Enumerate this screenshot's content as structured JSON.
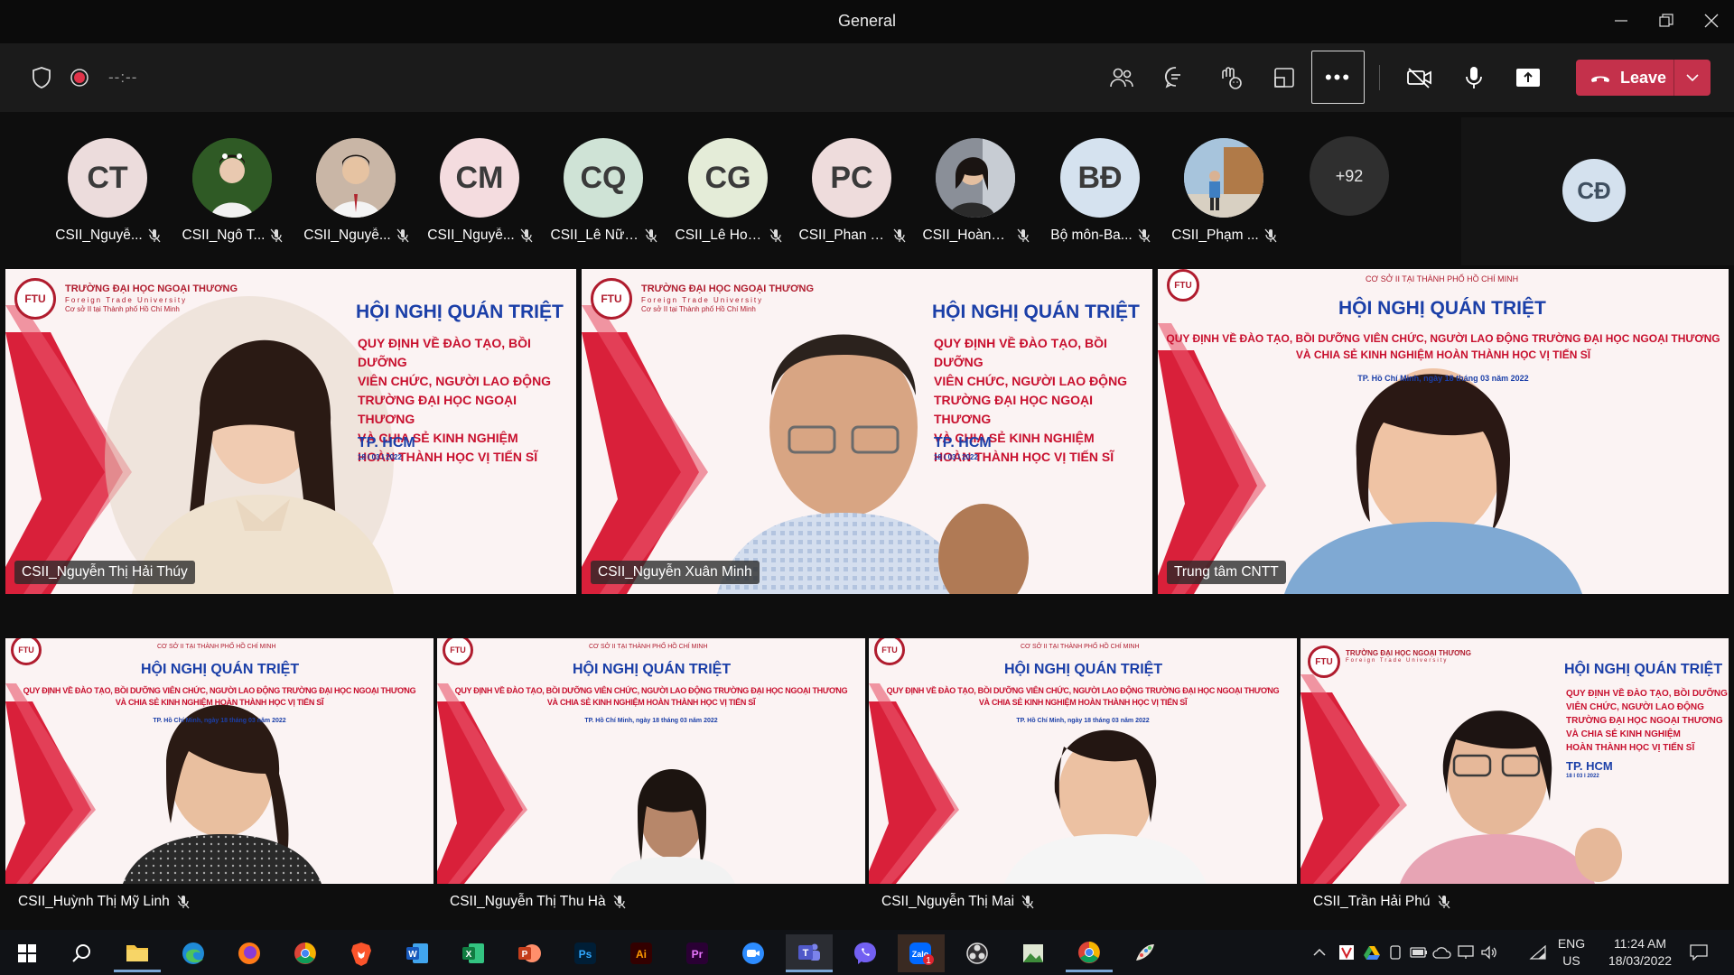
{
  "window": {
    "title": "General"
  },
  "toolbar": {
    "timer": "--:--",
    "more_label": "•••",
    "leave_label": "Leave"
  },
  "participants": [
    {
      "initials": "CT",
      "name": "CSII_Nguyễ...",
      "color": "#ecdcdc",
      "photo": false
    },
    {
      "initials": "",
      "name": "CSII_Ngô T...",
      "color": "#2f5a25",
      "photo": true
    },
    {
      "initials": "",
      "name": "CSII_Nguyễ...",
      "color": "#c9b6a6",
      "photo": true
    },
    {
      "initials": "CM",
      "name": "CSII_Nguyễ...",
      "color": "#f4dcdf",
      "photo": false
    },
    {
      "initials": "CQ",
      "name": "CSII_Lê Nữ ...",
      "color": "#cfe3d6",
      "photo": false
    },
    {
      "initials": "CG",
      "name": "CSII_Lê Hoà...",
      "color": "#e4ecd8",
      "photo": false
    },
    {
      "initials": "PC",
      "name": "CSII_Phan T...",
      "color": "#eedcdc",
      "photo": false
    },
    {
      "initials": "",
      "name": "CSII_Hoàng ...",
      "color": "#8a8f98",
      "photo": true
    },
    {
      "initials": "BĐ",
      "name": "Bộ môn-Ba...",
      "color": "#d5e2ef",
      "photo": false
    },
    {
      "initials": "",
      "name": "CSII_Phạm ...",
      "color": "#a7c4dc",
      "photo": true
    }
  ],
  "more_participants": "+92",
  "self": {
    "initials": "CĐ"
  },
  "tiles_top": [
    {
      "name": "CSII_Nguyễn Thị Hải Thúy"
    },
    {
      "name": "CSII_Nguyễn Xuân Minh"
    },
    {
      "name": "Trung tâm CNTT"
    }
  ],
  "tiles_bottom": [
    {
      "name": "CSII_Huỳnh Thị Mỹ Linh"
    },
    {
      "name": "CSII_Nguyễn Thị Thu Hà"
    },
    {
      "name": "CSII_Nguyễn Thị Mai"
    },
    {
      "name": "CSII_Trần Hải Phú"
    }
  ],
  "slide": {
    "school": "TRƯỜNG ĐẠI HỌC NGOẠI THƯƠNG",
    "school_en": "Foreign Trade University",
    "campus": "Cơ sở II tại Thành phố Hồ Chí Minh",
    "campus_caps": "CƠ SỞ II TẠI THÀNH PHỐ HỒ CHÍ MINH",
    "title": "HỘI NGHỊ QUÁN TRIỆT",
    "body_lines": [
      "QUY ĐỊNH VỀ ĐÀO TẠO, BỒI DƯỠNG",
      "VIÊN CHỨC, NGƯỜI LAO ĐỘNG",
      "TRƯỜNG ĐẠI HỌC NGOẠI THƯƠNG",
      "VÀ CHIA SẺ KINH NGHIỆM",
      "HOÀN THÀNH HỌC VỊ TIẾN SĨ"
    ],
    "wide_line1": "QUY ĐỊNH VỀ ĐÀO TẠO, BỒI DƯỠNG VIÊN CHỨC, NGƯỜI LAO ĐỘNG TRƯỜNG ĐẠI HỌC NGOẠI THƯƠNG",
    "wide_line2": "VÀ CHIA SẺ KINH NGHIỆM HOÀN THÀNH HỌC VỊ TIẾN SĨ",
    "city": "TP. HCM",
    "date": "18 I 03 I 2022",
    "date_long": "TP. Hồ Chí Minh, ngày 18 tháng 03 năm 2022"
  },
  "taskbar": {
    "apps": [
      "start-icon",
      "search-icon",
      "file-explorer-icon",
      "edge-icon",
      "firefox-icon",
      "chrome-icon",
      "brave-icon",
      "word-icon",
      "excel-icon",
      "powerpoint-icon",
      "photoshop-icon",
      "illustrator-icon",
      "premiere-icon",
      "zoom-icon",
      "teams-icon",
      "viber-icon",
      "zalo-icon",
      "obs-icon",
      "app-icon",
      "chrome-icon",
      "paint-icon"
    ],
    "zalo_badge": "1",
    "lang_line1": "ENG",
    "lang_line2": "US",
    "time": "11:24 AM",
    "date": "18/03/2022"
  }
}
